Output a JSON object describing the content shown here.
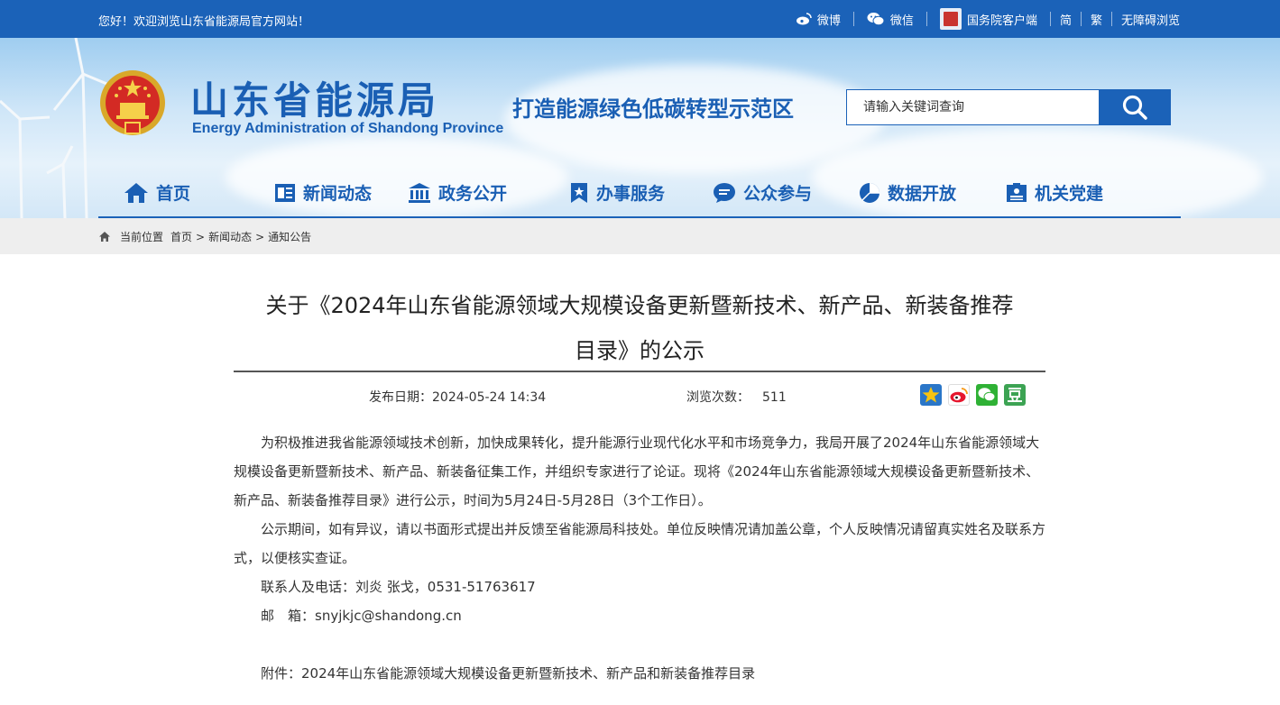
{
  "topbar": {
    "welcome": "您好！欢迎浏览山东省能源局官方网站！",
    "weibo": "微博",
    "weixin": "微信",
    "gwy_client": "国务院客户端",
    "simplified": "简",
    "traditional": "繁",
    "accessibility": "无障碍浏览"
  },
  "header": {
    "site_name": "山东省能源局",
    "site_name_en": "Energy Administration of Shandong Province",
    "slogan": "打造能源绿色低碳转型示范区",
    "search_placeholder": "请输入关键词查询"
  },
  "nav": [
    {
      "label": "首页",
      "icon": "home-icon"
    },
    {
      "label": "新闻动态",
      "icon": "news-icon"
    },
    {
      "label": "政务公开",
      "icon": "government-icon"
    },
    {
      "label": "办事服务",
      "icon": "bookmark-icon"
    },
    {
      "label": "公众参与",
      "icon": "chat-icon"
    },
    {
      "label": "数据开放",
      "icon": "pie-chart-icon"
    },
    {
      "label": "机关党建",
      "icon": "party-icon"
    }
  ],
  "breadcrumb": {
    "prefix": "当前位置",
    "items": [
      "首页",
      "新闻动态",
      "通知公告"
    ]
  },
  "article": {
    "title_line1": "关于《2024年山东省能源领域大规模设备更新暨新技术、新产品、新装备推荐",
    "title_line2": "目录》的公示",
    "publish_label": "发布日期：",
    "publish_date": "2024-05-24 14:34",
    "views_label": "浏览次数：",
    "views": "511",
    "paragraphs": [
      "为积极推进我省能源领域技术创新，加快成果转化，提升能源行业现代化水平和市场竞争力，我局开展了2024年山东省能源领域大规模设备更新暨新技术、新产品、新装备征集工作，并组织专家进行了论证。现将《2024年山东省能源领域大规模设备更新暨新技术、新产品、新装备推荐目录》进行公示，时间为5月24日-5月28日（3个工作日）。",
      "公示期间，如有异议，请以书面形式提出并反馈至省能源局科技处。单位反映情况请加盖公章，个人反映情况请留真实姓名及联系方式，以便核实查证。",
      "联系人及电话：刘炎 张戈，0531-51763617",
      "邮　箱：snyjkjc@shandong.cn"
    ],
    "attachment": "附件：2024年山东省能源领域大规模设备更新暨新技术、新产品和新装备推荐目录"
  },
  "share": [
    "qzone-icon",
    "weibo-icon",
    "wechat-icon",
    "douban-icon"
  ],
  "colors": {
    "brand": "#1b62b8",
    "crumb_bg": "#eeeeee"
  }
}
